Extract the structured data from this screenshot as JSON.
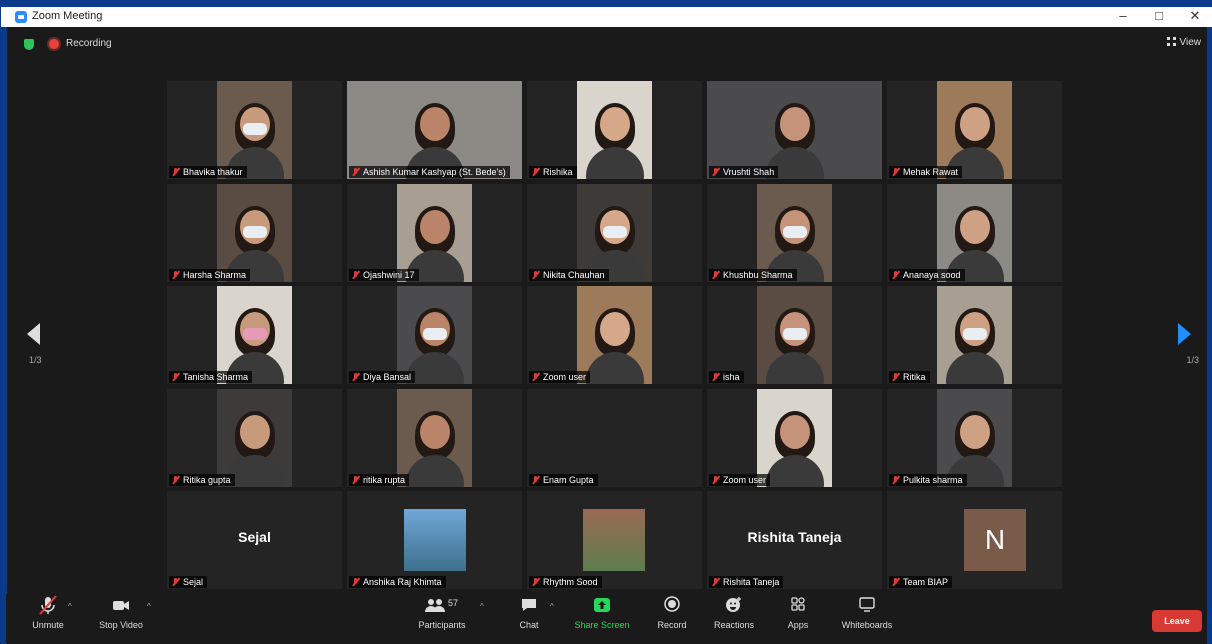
{
  "window": {
    "title": "Zoom Meeting",
    "controls": [
      "–",
      "□",
      "✕"
    ]
  },
  "top_bar": {
    "recording_label": "Recording",
    "view_label": "View"
  },
  "pagination": {
    "left": "1/3",
    "right": "1/3"
  },
  "participants_tiles": [
    {
      "name": "Bhavika thakur",
      "type": "video"
    },
    {
      "name": "Ashish Kumar Kashyap (St. Bede's)",
      "type": "video"
    },
    {
      "name": "Rishika",
      "type": "video"
    },
    {
      "name": "Vrushti Shah",
      "type": "video",
      "active_speaker": true
    },
    {
      "name": "Mehak Rawat",
      "type": "video"
    },
    {
      "name": "Harsha Sharma",
      "type": "video"
    },
    {
      "name": "Ojashwini 17",
      "type": "video"
    },
    {
      "name": "Nikita Chauhan",
      "type": "video"
    },
    {
      "name": "Khushbu Sharma",
      "type": "video"
    },
    {
      "name": "Ananaya sood",
      "type": "video"
    },
    {
      "name": "Tanisha Sharma",
      "type": "video"
    },
    {
      "name": "Diya Bansal",
      "type": "video"
    },
    {
      "name": "Zoom user",
      "type": "video"
    },
    {
      "name": "isha",
      "type": "video"
    },
    {
      "name": "Ritika",
      "type": "video"
    },
    {
      "name": "Ritika gupta",
      "type": "video"
    },
    {
      "name": "ritika rupta",
      "type": "video"
    },
    {
      "name": "Enam Gupta",
      "type": "blank"
    },
    {
      "name": "Zoom user",
      "type": "video"
    },
    {
      "name": "Pulkita sharma",
      "type": "video"
    },
    {
      "name": "Sejal",
      "type": "name",
      "display": "Sejal"
    },
    {
      "name": "Anshika Raj Khimta",
      "type": "photo"
    },
    {
      "name": "Rhythm Sood",
      "type": "photo"
    },
    {
      "name": "Rishita Taneja",
      "type": "name",
      "display": "Rishita Taneja"
    },
    {
      "name": "Team BIAP",
      "type": "avatar",
      "display": "N"
    }
  ],
  "toolbar": {
    "unmute": "Unmute",
    "stop_video": "Stop Video",
    "participants": "Participants",
    "participants_count": "57",
    "chat": "Chat",
    "share_screen": "Share Screen",
    "record": "Record",
    "reactions": "Reactions",
    "apps": "Apps",
    "whiteboards": "Whiteboards",
    "leave": "Leave"
  },
  "colors": {
    "accent_blue": "#1e90ff",
    "share_green": "#23d959",
    "leave_red": "#d63a32",
    "active_speaker": "#d8e34a"
  }
}
